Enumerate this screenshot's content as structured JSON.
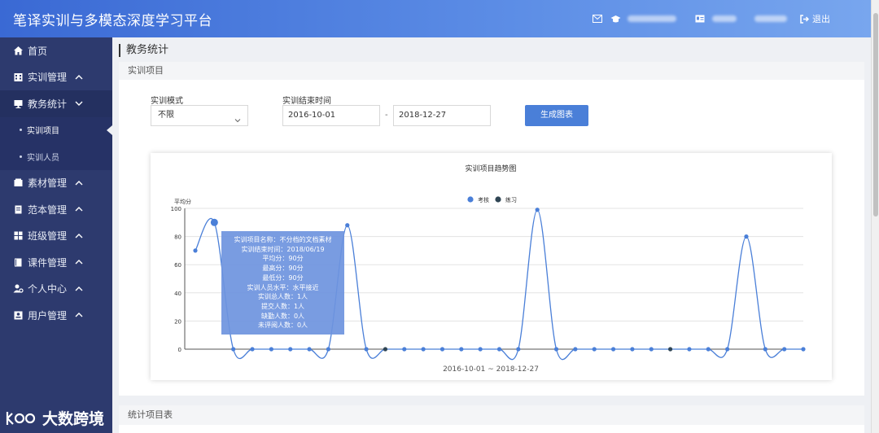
{
  "header": {
    "title": "笔译实训与多模态深度学习平台",
    "logout": "退出"
  },
  "sidebar": {
    "items": [
      {
        "label": "首页",
        "icon": "home-icon"
      },
      {
        "label": "实训管理",
        "icon": "building-icon"
      },
      {
        "label": "教务统计",
        "icon": "monitor-icon"
      },
      {
        "label": "实训项目",
        "icon": ""
      },
      {
        "label": "实训人员",
        "icon": ""
      },
      {
        "label": "素材管理",
        "icon": "folder-icon"
      },
      {
        "label": "范本管理",
        "icon": "document-icon"
      },
      {
        "label": "班级管理",
        "icon": "grid-icon"
      },
      {
        "label": "课件管理",
        "icon": "book-icon"
      },
      {
        "label": "个人中心",
        "icon": "user-gear-icon"
      },
      {
        "label": "用户管理",
        "icon": "id-card-icon"
      }
    ]
  },
  "page": {
    "title": "教务统计",
    "section1": "实训项目",
    "section2": "统计项目表"
  },
  "filters": {
    "mode_label": "实训模式",
    "mode_value": "不限",
    "end_time_label": "实训结束时间",
    "date_from": "2016-10-01",
    "date_sep": "-",
    "date_to": "2018-12-27",
    "generate_button": "生成图表"
  },
  "chart_data": {
    "type": "line",
    "title": "实训项目趋势图",
    "ylabel": "平均分",
    "xlabel": "2016-10-01 ~ 2018-12-27",
    "ylim": [
      0,
      100
    ],
    "yticks": [
      0,
      20,
      40,
      60,
      80,
      100
    ],
    "grid": true,
    "legend_position": "top-center",
    "series": [
      {
        "name": "考核",
        "color": "#4a7fd8"
      },
      {
        "name": "练习",
        "color": "#2f4554"
      }
    ],
    "values": [
      70,
      90,
      0,
      0,
      0,
      0,
      0,
      0,
      88,
      0,
      0,
      0,
      0,
      0,
      0,
      0,
      0,
      0,
      99,
      0,
      0,
      0,
      0,
      0,
      0,
      0,
      0,
      0,
      0,
      80,
      0,
      0,
      0
    ],
    "point_series": [
      0,
      0,
      0,
      0,
      0,
      0,
      0,
      0,
      0,
      0,
      1,
      0,
      0,
      0,
      0,
      0,
      0,
      0,
      0,
      0,
      0,
      0,
      0,
      0,
      0,
      1,
      0,
      0,
      0,
      0,
      0,
      0,
      0
    ],
    "highlight_index": 1
  },
  "tooltip": {
    "rows": [
      "实训项目名称：不分档的文档素材",
      "实训结束时间：2018/06/19",
      "平均分：90分",
      "最高分：90分",
      "最低分：90分",
      "实训人员水平：水平接近",
      "实训总人数：1人",
      "提交人数：1人",
      "缺勤人数：0人",
      "未评阅人数：0人"
    ]
  },
  "watermark": {
    "text": "大数跨境"
  }
}
